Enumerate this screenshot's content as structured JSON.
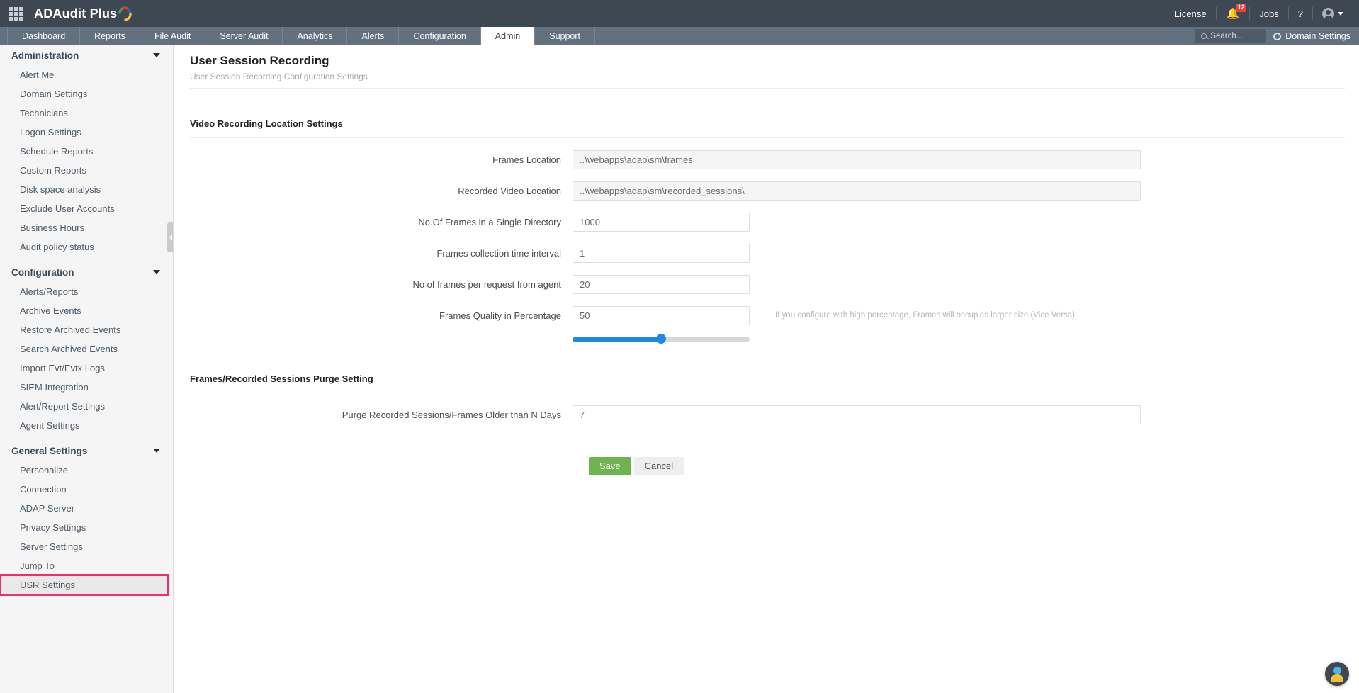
{
  "header": {
    "app_name": "ADAudit Plus",
    "apps_icon": "grid-apps-icon",
    "license_label": "License",
    "notifications_icon": "bell-icon",
    "notifications_count": "12",
    "jobs_label": "Jobs",
    "help_label": "?",
    "account_icon": "user-account-icon"
  },
  "nav": {
    "tabs": [
      {
        "label": "Dashboard",
        "active": false
      },
      {
        "label": "Reports",
        "active": false
      },
      {
        "label": "File Audit",
        "active": false
      },
      {
        "label": "Server Audit",
        "active": false
      },
      {
        "label": "Analytics",
        "active": false
      },
      {
        "label": "Alerts",
        "active": false
      },
      {
        "label": "Configuration",
        "active": false
      },
      {
        "label": "Admin",
        "active": true
      },
      {
        "label": "Support",
        "active": false
      }
    ],
    "search_placeholder": "Search...",
    "search_value": "",
    "search_icon": "search-icon",
    "domain_settings_label": "Domain Settings",
    "domain_settings_icon": "gear-icon"
  },
  "sidebar": {
    "groups": [
      {
        "title": "Administration",
        "items": [
          "Alert Me",
          "Domain Settings",
          "Technicians",
          "Logon Settings",
          "Schedule Reports",
          "Custom Reports",
          "Disk space analysis",
          "Exclude User Accounts",
          "Business Hours",
          "Audit policy status"
        ]
      },
      {
        "title": "Configuration",
        "items": [
          "Alerts/Reports",
          "Archive Events",
          "Restore Archived Events",
          "Search Archived Events",
          "Import Evt/Evtx Logs",
          "SIEM Integration",
          "Alert/Report Settings",
          "Agent Settings"
        ]
      },
      {
        "title": "General Settings",
        "items": [
          "Personalize",
          "Connection",
          "ADAP Server",
          "Privacy Settings",
          "Server Settings",
          "Jump To",
          "USR Settings"
        ]
      }
    ],
    "selected_item": "USR Settings",
    "selected_outline_color": "#ef2f6a",
    "collapse_handle_icon": "chevron-left-icon"
  },
  "page": {
    "title": "User Session Recording",
    "subtitle": "User Session Recording Configuration Settings"
  },
  "video_section": {
    "title": "Video Recording Location Settings",
    "fields": [
      {
        "label": "Frames Location",
        "value": "..\\webapps\\adap\\sm\\frames",
        "readonly": true
      },
      {
        "label": "Recorded Video Location",
        "value": "..\\webapps\\adap\\sm\\recorded_sessions\\",
        "readonly": true
      },
      {
        "label": "No.Of Frames in a Single Directory",
        "value": "1000",
        "readonly": false
      },
      {
        "label": "Frames collection time interval",
        "value": "1",
        "readonly": false
      },
      {
        "label": "No of frames per request from agent",
        "value": "20",
        "readonly": false
      }
    ],
    "quality": {
      "label": "Frames Quality in Percentage",
      "value": "50",
      "slider_percent": 50,
      "slider_color": "#1e88e5",
      "hint": "If you configure with high percentage, Frames will occupies larger size (Vice Versa)"
    }
  },
  "purge_section": {
    "title": "Frames/Recorded Sessions Purge Setting",
    "field": {
      "label": "Purge Recorded Sessions/Frames Older than N Days",
      "value": "7"
    }
  },
  "actions": {
    "save_label": "Save",
    "save_color": "#6fb350",
    "cancel_label": "Cancel"
  },
  "support_fab": {
    "icon": "support-agent-icon"
  }
}
